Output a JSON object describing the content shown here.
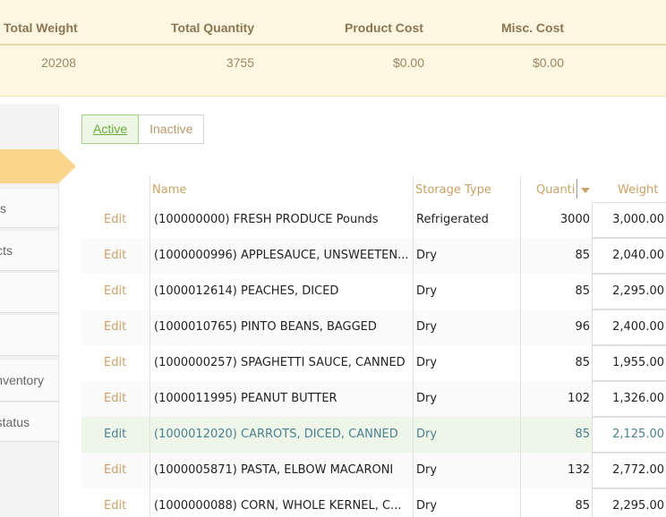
{
  "summary": {
    "headers": [
      "Total Weight",
      "Total Quantity",
      "Product Cost",
      "Misc. Cost"
    ],
    "values": [
      "20208",
      "3755",
      "$0.00",
      "$0.00"
    ]
  },
  "sidebar": {
    "items": [
      "s",
      "cts",
      "",
      "",
      "nventory",
      "status"
    ]
  },
  "toggle": {
    "active": "Active",
    "inactive": "Inactive"
  },
  "table": {
    "columns": {
      "name": "Name",
      "storage": "Storage Type",
      "quantity": "Quanti",
      "weight": "Weight"
    },
    "edit_label": "Edit",
    "rows": [
      {
        "name": "(100000000) FRESH PRODUCE Pounds",
        "storage": "Refrigerated",
        "qty": "3000",
        "weight": "3,000.00"
      },
      {
        "name": "(1000000996) APPLESAUCE, UNSWEETEN...",
        "storage": "Dry",
        "qty": "85",
        "weight": "2,040.00"
      },
      {
        "name": "(1000012614) PEACHES, DICED",
        "storage": "Dry",
        "qty": "85",
        "weight": "2,295.00"
      },
      {
        "name": "(1000010765) PINTO BEANS, BAGGED",
        "storage": "Dry",
        "qty": "96",
        "weight": "2,400.00"
      },
      {
        "name": "(1000000257) SPAGHETTI SAUCE, CANNED",
        "storage": "Dry",
        "qty": "85",
        "weight": "1,955.00"
      },
      {
        "name": "(1000011995) PEANUT BUTTER",
        "storage": "Dry",
        "qty": "102",
        "weight": "1,326.00"
      },
      {
        "name": "(1000012020) CARROTS, DICED, CANNED",
        "storage": "Dry",
        "qty": "85",
        "weight": "2,125.00"
      },
      {
        "name": "(1000005871) PASTA, ELBOW MACARONI",
        "storage": "Dry",
        "qty": "132",
        "weight": "2,772.00"
      },
      {
        "name": "(1000000088) CORN, WHOLE KERNEL, C...",
        "storage": "Dry",
        "qty": "85",
        "weight": "2,295.00"
      }
    ]
  }
}
